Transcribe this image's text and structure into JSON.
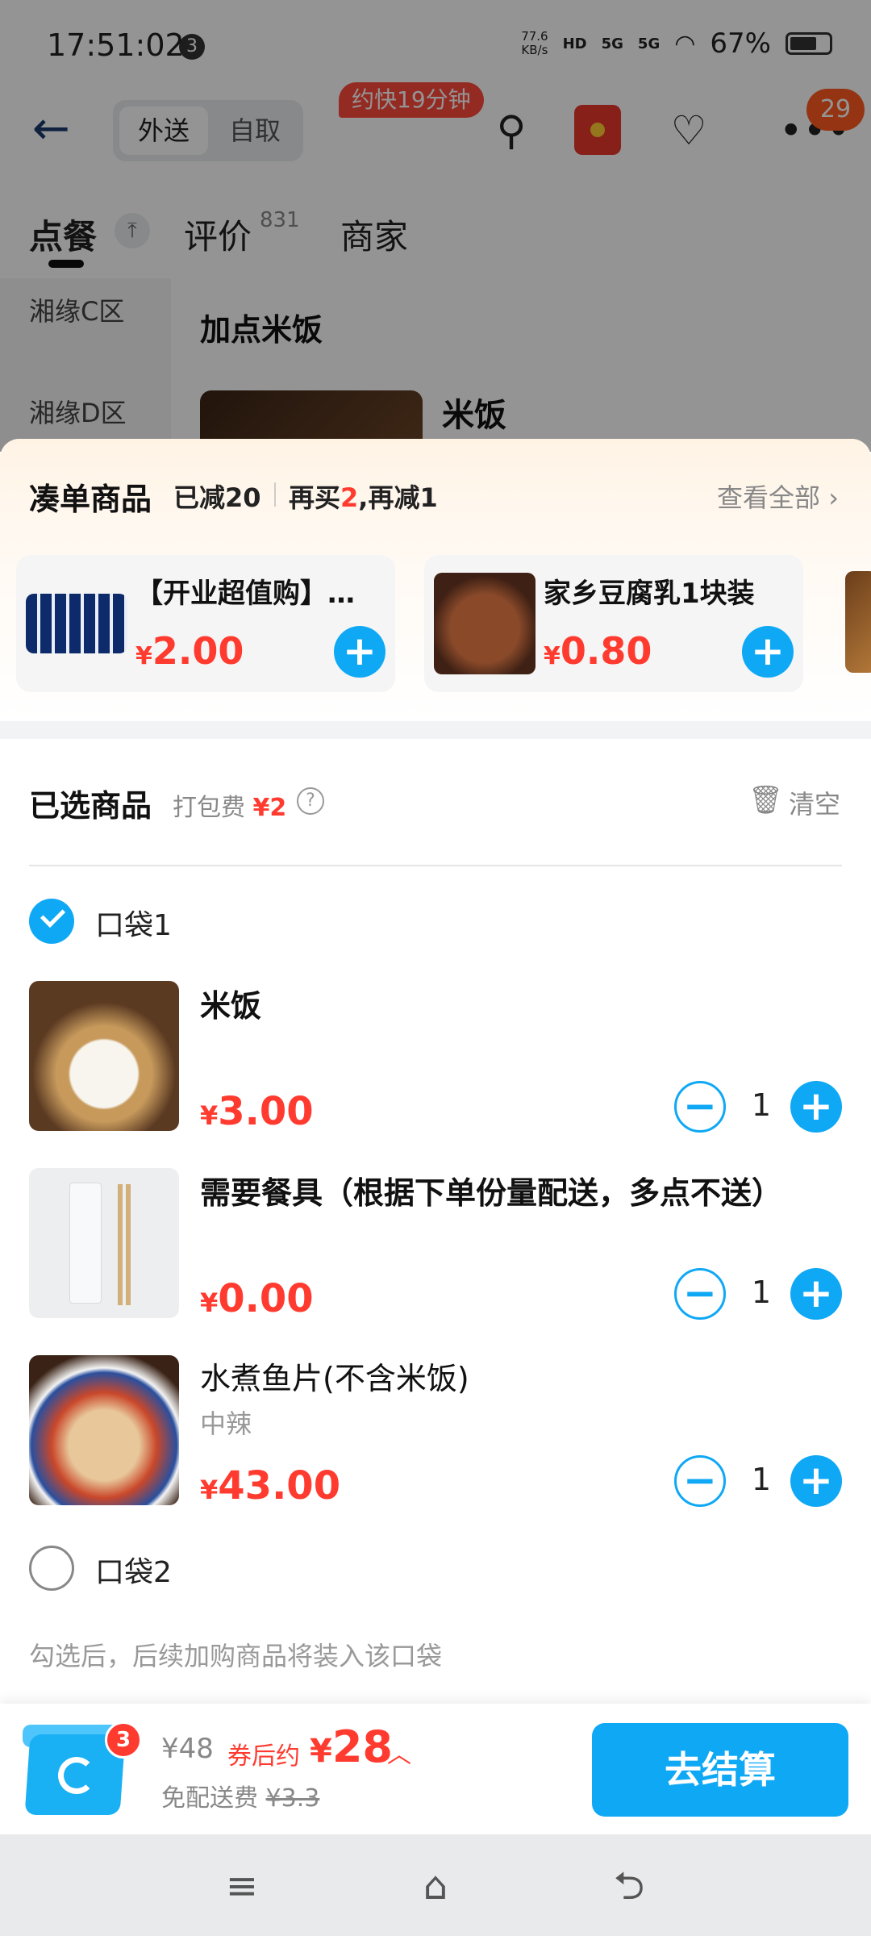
{
  "status_bar": {
    "time": "17:51:02",
    "notification_count": "3",
    "net_speed_value": "77.6",
    "net_speed_unit": "KB/s",
    "hd_label": "HD",
    "signal1": "5G",
    "signal2": "5G",
    "battery": "67%"
  },
  "top_nav": {
    "delivery_label": "外送",
    "pickup_label": "自取",
    "eta_badge": "约快19分钟",
    "more_badge": "29"
  },
  "tabs": {
    "order_label": "点餐",
    "reviews_label": "评价",
    "reviews_count": "831",
    "merchant_label": "商家"
  },
  "background_menu": {
    "categories": [
      "湘缘C区",
      "湘缘D区"
    ],
    "section_title": "加点米饭",
    "peek_item_name": "米饭"
  },
  "bundle": {
    "title": "凑单商品",
    "reduced": "已减20",
    "promo_prefix": "再买",
    "promo_count": "2",
    "promo_suffix": ",再减1",
    "view_all": "查看全部",
    "cards": [
      {
        "name": "【开业超值购】百事可乐",
        "currency": "¥",
        "price": "2.00"
      },
      {
        "name": "家乡豆腐乳1块装",
        "currency": "¥",
        "price": "0.80"
      }
    ]
  },
  "selected": {
    "title": "已选商品",
    "packing_fee_label": "打包费",
    "packing_fee_amount": "¥2",
    "clear_label": "清空",
    "bag1_label": "口袋1",
    "bag2_label": "口袋2",
    "bag_hint": "勾选后，后续加购商品将装入该口袋",
    "items": [
      {
        "name": "米饭",
        "spec": "",
        "currency": "¥",
        "price": "3.00",
        "qty": "1"
      },
      {
        "name": "需要餐具（根据下单份量配送，多点不送）",
        "spec": "",
        "currency": "¥",
        "price": "0.00",
        "qty": "1"
      },
      {
        "name": "水煮鱼片(不含米饭)",
        "spec": "中辣",
        "currency": "¥",
        "price": "43.00",
        "qty": "1"
      }
    ]
  },
  "checkout": {
    "cart_count": "3",
    "original_total": "¥48",
    "after_coupon_label": "券后约",
    "final_currency": "¥",
    "final_total": "28",
    "free_delivery_label": "免配送费",
    "delivery_fee_strike": "¥3.3",
    "checkout_label": "去结算"
  },
  "colors": {
    "accent_blue": "#0fa8f5",
    "price_red": "#ff3b30",
    "eta_red": "#ff4a3d"
  }
}
